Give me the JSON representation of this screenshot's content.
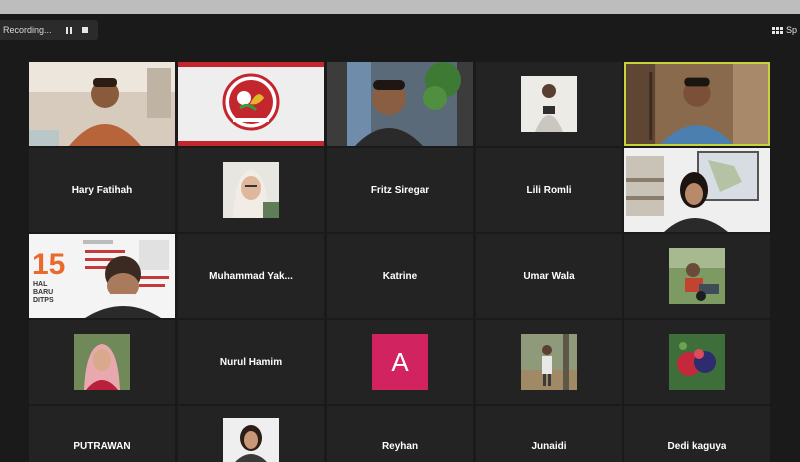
{
  "recording": {
    "label": "Recording..."
  },
  "view": {
    "label": "Sp"
  },
  "participants": [
    {
      "name": "Hary Fatihah"
    },
    {
      "name": "Fritz Siregar"
    },
    {
      "name": "Lili Romli"
    },
    {
      "name": "Muhammad  Yak..."
    },
    {
      "name": "Katrine"
    },
    {
      "name": "Umar Wala"
    },
    {
      "name": "Nurul Hamim",
      "avatar_letter": "A"
    },
    {
      "name": "PUTRAWAN"
    },
    {
      "name": "Reyhan"
    },
    {
      "name": "Junaidi"
    },
    {
      "name": "Dedi kaguya"
    }
  ],
  "slide": {
    "number": "15",
    "line1": "HAL",
    "line2": "BARU",
    "line3": "DITPS"
  },
  "colors": {
    "active_border": "#c7d33a",
    "avatar_bg": "#d1235f",
    "tile_bg": "#232323"
  }
}
